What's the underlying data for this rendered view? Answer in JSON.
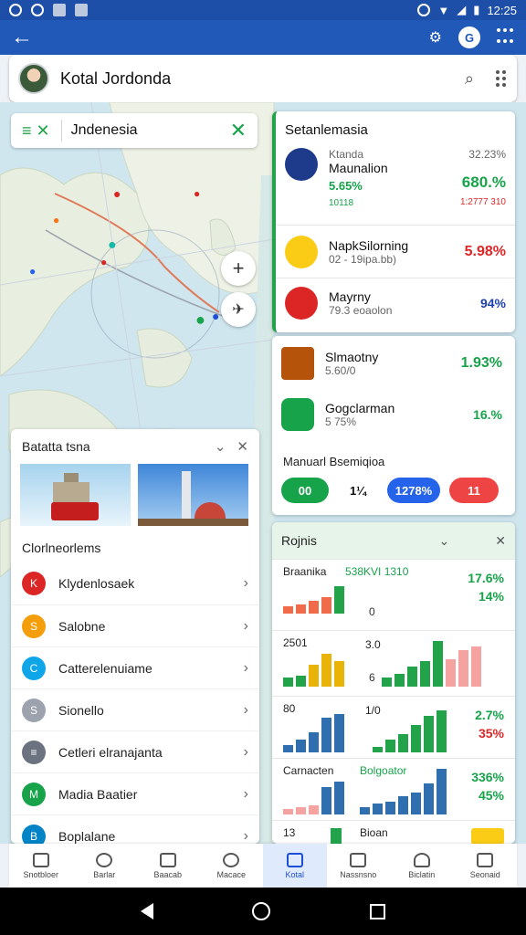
{
  "status_bar": {
    "time": "12:25"
  },
  "top_bar": {
    "title": "Kotal Jordonda"
  },
  "map": {
    "search_text": "Jndenesia",
    "zoom_in": "+"
  },
  "left_card": {
    "header": "Batatta tsna",
    "section_title": "Clorlneorlems",
    "items": [
      {
        "label": "Klydenlosaek",
        "color": "#dc2626",
        "icon": "K"
      },
      {
        "label": "Salobne",
        "color": "#f59e0b",
        "icon": "S"
      },
      {
        "label": "Catterelenuiame",
        "color": "#0ea5e9",
        "icon": "C"
      },
      {
        "label": "Sionello",
        "color": "#9ca3af",
        "icon": "S"
      },
      {
        "label": "Cetleri elranajanta",
        "color": "#6b7280",
        "icon": "≡"
      },
      {
        "label": "Madia Baatier",
        "color": "#16a34a",
        "icon": "M"
      },
      {
        "label": "Boplalane",
        "color": "#0284c7",
        "icon": "B"
      }
    ]
  },
  "right_card_1": {
    "title": "Setanlemasia",
    "rows": [
      {
        "name": "Maunalion",
        "meta": "Ktanda",
        "pct": "5.65%",
        "sub": "10118",
        "value": "32.23%",
        "value2": "680.%",
        "value3": "1:2777 310",
        "icon_color": "#1e3a8a"
      },
      {
        "name": "NapkSilorning",
        "meta": "",
        "pct": "",
        "sub": "02 - 19ipa.bb)",
        "value": "5.98%",
        "value2": "",
        "value3": "",
        "icon_color": "#facc15"
      },
      {
        "name": "Mayrny",
        "meta": "",
        "pct": "",
        "sub": "79.3 eoaolon",
        "value": "94%",
        "value2": "",
        "value3": "",
        "icon_color": "#dc2626"
      }
    ]
  },
  "right_card_2": {
    "rows": [
      {
        "name": "Slmaotny",
        "sub": "5.60/0",
        "value": "1.93%"
      },
      {
        "name": "Gogclarman",
        "sub": "5 75%",
        "value": "16.%"
      }
    ],
    "label": "Manuarl Bsemiqioa",
    "pills": [
      "00",
      "1¼",
      "1278%",
      "11"
    ]
  },
  "right_card_3": {
    "title": "Rojnis",
    "charts": [
      {
        "label": "Braanika",
        "label2": "538KVI 1310",
        "mid": "0",
        "values": [
          "17.6%",
          "14%"
        ]
      },
      {
        "label": "2501",
        "label2": "3.0",
        "mid": "6",
        "values": [
          "",
          ""
        ]
      },
      {
        "label": "80",
        "label2": "1/0",
        "mid": "",
        "values": [
          "2.7%",
          "35%"
        ]
      },
      {
        "label": "Carnacten",
        "label2": "Bolgoator",
        "mid": "",
        "values": [
          "336%",
          "45%"
        ]
      },
      {
        "label": "13",
        "label2": "Bioan",
        "mid": "",
        "values": [
          "",
          ""
        ]
      }
    ]
  },
  "bottom_nav": {
    "items": [
      "Snotbloer",
      "Barlar",
      "Baacab",
      "Macace",
      "Kotal",
      "Nassnsno",
      "Biclatin",
      "Seonaid"
    ]
  }
}
